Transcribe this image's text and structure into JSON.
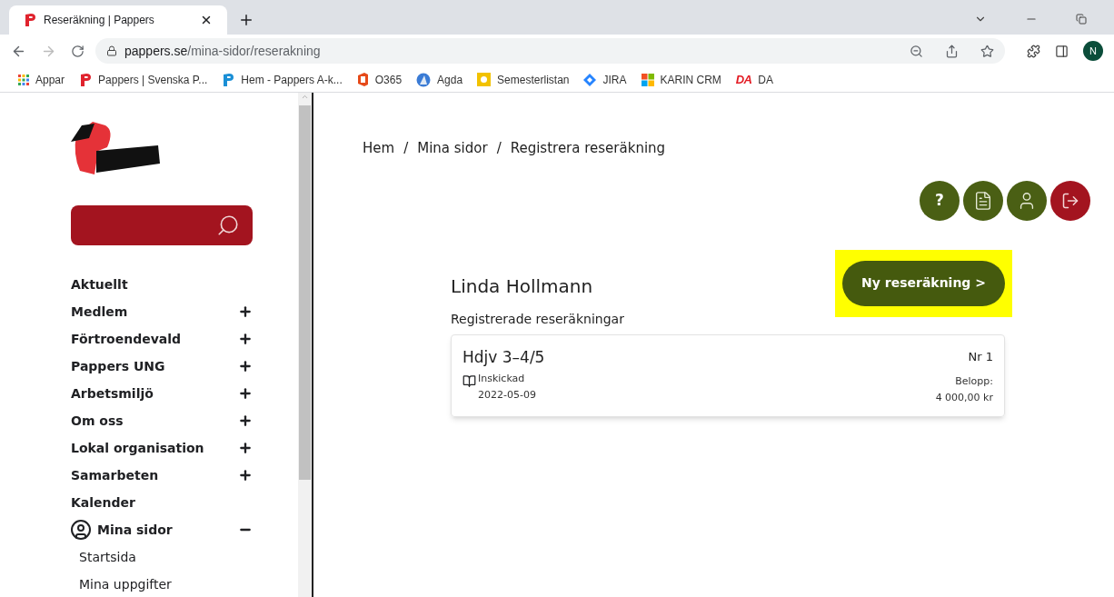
{
  "browser": {
    "tab_title": "Reseräkning | Pappers",
    "url_host": "pappers.se",
    "url_path": "/mina-sidor/reserakning",
    "profile_initial": "N",
    "bookmarks": [
      {
        "kind": "apps",
        "label": "Appar"
      },
      {
        "kind": "pappers",
        "label": "Pappers | Svenska P..."
      },
      {
        "kind": "blue-p",
        "label": "Hem - Pappers A-k..."
      },
      {
        "kind": "office",
        "label": "O365"
      },
      {
        "kind": "agda",
        "label": "Agda"
      },
      {
        "kind": "sun",
        "label": "Semesterlistan"
      },
      {
        "kind": "jira",
        "label": "JIRA"
      },
      {
        "kind": "windows",
        "label": "KARIN CRM"
      },
      {
        "kind": "da",
        "label": "DA",
        "badge": "DA"
      }
    ]
  },
  "sidebar": {
    "items": [
      {
        "label": "Aktuellt",
        "kind": "link"
      },
      {
        "label": "Medlem",
        "kind": "expandable",
        "expanded": false
      },
      {
        "label": "Förtroendevald",
        "kind": "expandable",
        "expanded": false
      },
      {
        "label": "Pappers UNG",
        "kind": "expandable",
        "expanded": false
      },
      {
        "label": "Arbetsmiljö",
        "kind": "expandable",
        "expanded": false
      },
      {
        "label": "Om oss",
        "kind": "expandable",
        "expanded": false
      },
      {
        "label": "Lokal organisation",
        "kind": "expandable",
        "expanded": false
      },
      {
        "label": "Samarbeten",
        "kind": "expandable",
        "expanded": false
      },
      {
        "label": "Kalender",
        "kind": "link"
      },
      {
        "label": "Mina sidor",
        "kind": "account",
        "expanded": true,
        "children": [
          {
            "label": "Startsida"
          },
          {
            "label": "Mina uppgifter"
          }
        ]
      }
    ]
  },
  "breadcrumb": [
    {
      "label": "Hem"
    },
    {
      "separator": "/",
      "label": "Mina sidor"
    },
    {
      "separator": "/",
      "label": "Registrera reseräkning"
    }
  ],
  "help_button": "?",
  "user_name": "Linda Hollmann",
  "new_button": "Ny reseräkning >",
  "list_title": "Registrerade reseräkningar",
  "claims": [
    {
      "title": "Hdjv 3–4/5",
      "status": "Inskickad",
      "date": "2022-05-09",
      "number": "Nr 1",
      "amount_label": "Belopp:",
      "amount": "4 000,00 kr"
    }
  ]
}
